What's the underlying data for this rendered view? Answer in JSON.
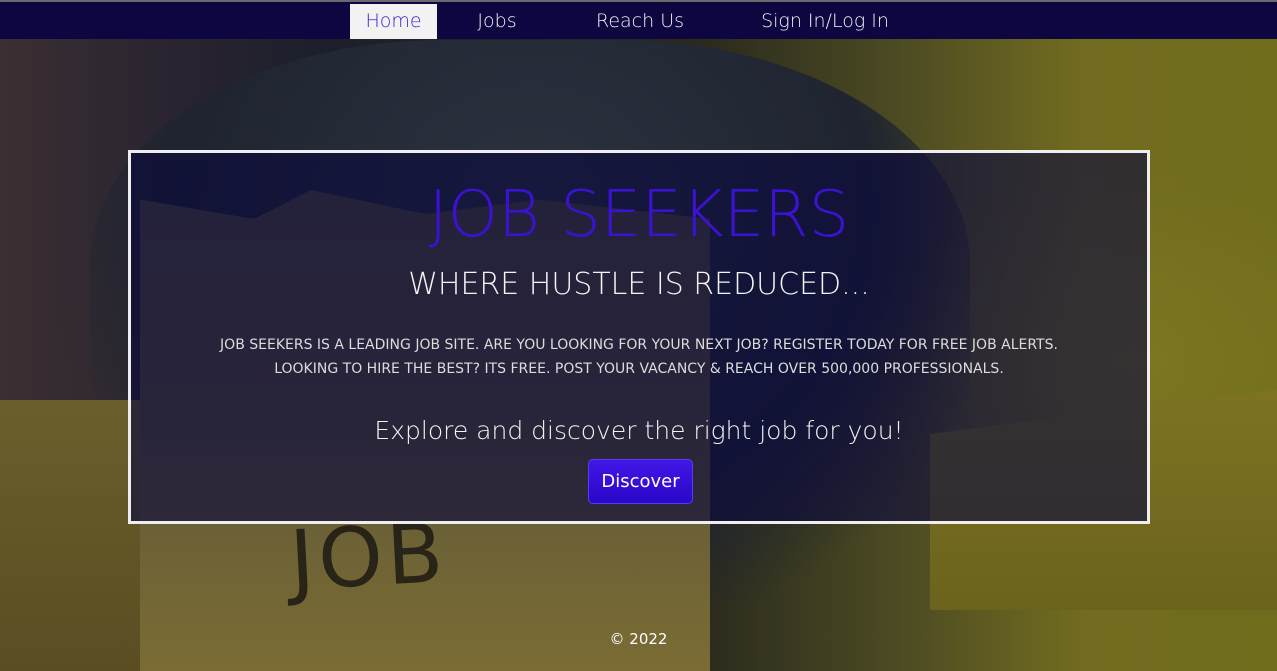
{
  "nav": {
    "items": [
      {
        "label": "Home",
        "active": true
      },
      {
        "label": "Jobs",
        "active": false
      },
      {
        "label": "Reach Us",
        "active": false
      },
      {
        "label": "Sign In/Log In",
        "active": false
      }
    ]
  },
  "hero": {
    "title": "JOB SEEKERS",
    "subtitle": "WHERE HUSTLE IS REDUCED...",
    "description_line1": "JOB SEEKERS IS A LEADING JOB SITE. ARE YOU LOOKING FOR YOUR NEXT JOB? REGISTER TODAY FOR FREE JOB ALERTS.",
    "description_line2": "LOOKING TO HIRE THE BEST? ITS FREE. POST YOUR VACANCY & REACH OVER 500,000 PROFESSIONALS.",
    "tagline": "Explore and discover the right job for you!",
    "cta_label": "Discover"
  },
  "footer": {
    "copyright": "© 2022"
  },
  "colors": {
    "nav_bg": "#0d0640",
    "accent": "#3a12cf",
    "button": "#2b06c8"
  }
}
